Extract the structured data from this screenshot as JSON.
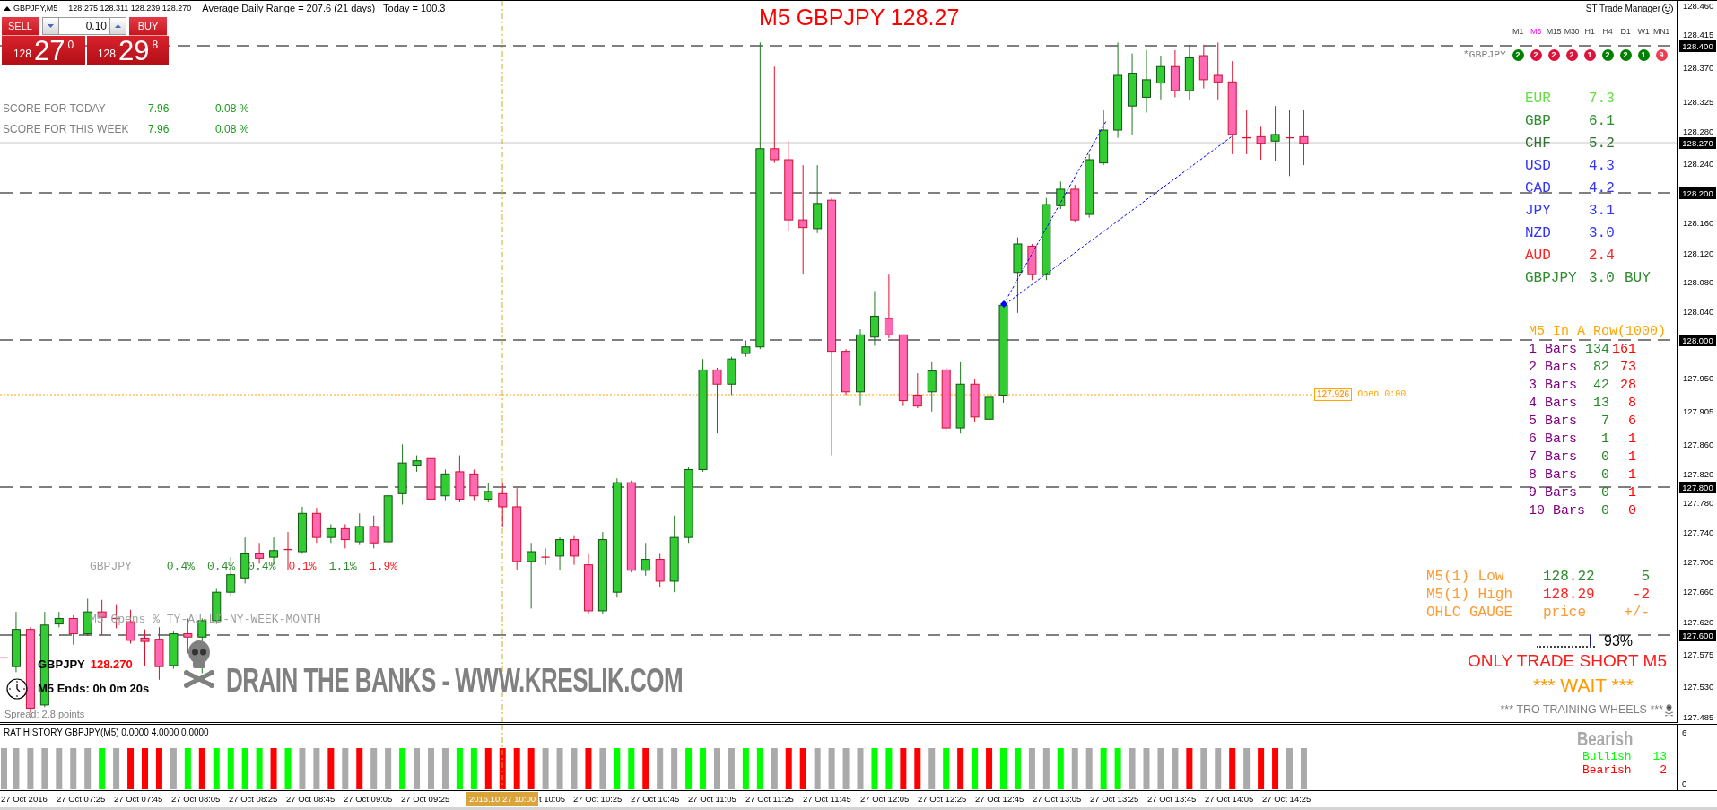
{
  "header": {
    "symbol": "GBPJPY,M5",
    "quotes": "128.275 128.311 128.239 128.270",
    "range": "Average Daily Range = 207.6 (21 days)",
    "today": "Today = 100.3"
  },
  "trade_panel": {
    "sell": {
      "label": "SELL",
      "big_figure": "128",
      "pips": "27",
      "fraction": "0"
    },
    "lot": "0.10",
    "buy": {
      "label": "BUY",
      "big_figure": "128",
      "pips": "29",
      "fraction": "8"
    }
  },
  "scores": [
    {
      "label": "SCORE FOR TODAY",
      "points": "7.96",
      "percent": "0.08 %"
    },
    {
      "label": "SCORE FOR THIS WEEK",
      "points": "7.96",
      "percent": "0.08 %"
    }
  ],
  "chart_title": "M5 GBPJPY 128.27",
  "trade_manager": "ST Trade Manager",
  "trend_matrix": {
    "symbol": "*GBPJPY",
    "timeframes": [
      {
        "label": "M1",
        "selected": false,
        "count": "2",
        "color": "#008000"
      },
      {
        "label": "M5",
        "selected": true,
        "count": "2",
        "color": "#dc143c"
      },
      {
        "label": "M15",
        "selected": false,
        "count": "2",
        "color": "#dc143c"
      },
      {
        "label": "M30",
        "selected": false,
        "count": "2",
        "color": "#dc143c"
      },
      {
        "label": "H1",
        "selected": false,
        "count": "1",
        "color": "#dc143c"
      },
      {
        "label": "H4",
        "selected": false,
        "count": "2",
        "color": "#008000"
      },
      {
        "label": "D1",
        "selected": false,
        "count": "2",
        "color": "#008000"
      },
      {
        "label": "W1",
        "selected": false,
        "count": "1",
        "color": "#008000"
      },
      {
        "label": "MN1",
        "selected": false,
        "count": "9",
        "color": "#f03c50"
      }
    ]
  },
  "currency_strength": [
    {
      "name": "EUR",
      "value": "7.3",
      "color": "#66dd44"
    },
    {
      "name": "GBP",
      "value": "6.1",
      "color": "#2e8b2e"
    },
    {
      "name": "CHF",
      "value": "5.2",
      "color": "#2f6f2f"
    },
    {
      "name": "USD",
      "value": "4.3",
      "color": "#3333ff"
    },
    {
      "name": "CAD",
      "value": "4.2",
      "color": "#3333ff"
    },
    {
      "name": "JPY",
      "value": "3.1",
      "color": "#3333ff"
    },
    {
      "name": "NZD",
      "value": "3.0",
      "color": "#3333ff"
    },
    {
      "name": "AUD",
      "value": "2.4",
      "color": "#ff2222"
    },
    {
      "name": "GBPJPY",
      "value": "3.0",
      "signal": "BUY",
      "color": "#2e8b2e"
    }
  ],
  "in_a_row": {
    "title": "M5 In A Row(1000)",
    "rows": [
      {
        "label": "1 Bars",
        "bullish": "134",
        "bearish": "161"
      },
      {
        "label": "2 Bars",
        "bullish": "82",
        "bearish": "73"
      },
      {
        "label": "3 Bars",
        "bullish": "42",
        "bearish": "28"
      },
      {
        "label": "4 Bars",
        "bullish": "13",
        "bearish": "8"
      },
      {
        "label": "5 Bars",
        "bullish": "7",
        "bearish": "6"
      },
      {
        "label": "6 Bars",
        "bullish": "1",
        "bearish": "1"
      },
      {
        "label": "7 Bars",
        "bullish": "0",
        "bearish": "1"
      },
      {
        "label": "8 Bars",
        "bullish": "0",
        "bearish": "1"
      },
      {
        "label": "9 Bars",
        "bullish": "0",
        "bearish": "1"
      },
      {
        "label": "10 Bars",
        "bullish": "0",
        "bearish": "0"
      }
    ]
  },
  "open_marker": {
    "price": "127.926",
    "label": "Open 0:00"
  },
  "ohlc_gauge": {
    "rows": [
      {
        "label": "M5(1) Low",
        "price": "128.22",
        "change": "5",
        "color": "#2e8b2e"
      },
      {
        "label": "M5(1) High",
        "price": "128.29",
        "change": "-2",
        "color": "#ff2222"
      },
      {
        "label": "OHLC GAUGE",
        "price": "price",
        "change": "+/-",
        "color": "#ff9933"
      }
    ],
    "level": 0.93,
    "reading": "93%"
  },
  "signal": {
    "advice": "ONLY TRADE SHORT M5",
    "action": "*** WAIT ***",
    "footer": "*** TRO TRAINING WHEELS ***"
  },
  "session_opens": {
    "symbol": "GBPJPY",
    "values": [
      {
        "text": "0.4%",
        "color": "#2e8b2e"
      },
      {
        "text": "0.4%",
        "color": "#2e8b2e"
      },
      {
        "text": "0.4%",
        "color": "#2e8b2e"
      },
      {
        "text": "0.1%",
        "color": "#ff2222"
      },
      {
        "text": "1.1%",
        "color": "#2e8b2e"
      },
      {
        "text": "1.9%",
        "color": "#ff2222"
      }
    ],
    "caption": "M5 Opens % TY-AU-LD-NY-WEEK-MONTH"
  },
  "countdown": {
    "symbol": "GBPJPY",
    "price": "128.270",
    "ends": "M5 Ends: 0h 0m 20s",
    "spread": "Spread: 2.8 points"
  },
  "banner": "DRAIN THE BANKS - WWW.KRESLIK.COM",
  "price_axis": [
    {
      "label": "128.460",
      "kind": "tick"
    },
    {
      "label": "128.415",
      "kind": "tick"
    },
    {
      "label": "128.400",
      "kind": "marker"
    },
    {
      "label": "128.370",
      "kind": "tick"
    },
    {
      "label": "128.325",
      "kind": "tick"
    },
    {
      "label": "128.280",
      "kind": "tick"
    },
    {
      "label": "128.270",
      "kind": "marker"
    },
    {
      "label": "128.240",
      "kind": "tick"
    },
    {
      "label": "128.200",
      "kind": "marker"
    },
    {
      "label": "128.160",
      "kind": "tick"
    },
    {
      "label": "128.120",
      "kind": "tick"
    },
    {
      "label": "128.080",
      "kind": "tick"
    },
    {
      "label": "128.040",
      "kind": "tick"
    },
    {
      "label": "128.000",
      "kind": "marker"
    },
    {
      "label": "127.950",
      "kind": "tick"
    },
    {
      "label": "127.905",
      "kind": "tick"
    },
    {
      "label": "127.860",
      "kind": "tick"
    },
    {
      "label": "127.820",
      "kind": "tick"
    },
    {
      "label": "127.800",
      "kind": "marker"
    },
    {
      "label": "127.780",
      "kind": "tick"
    },
    {
      "label": "127.740",
      "kind": "tick"
    },
    {
      "label": "127.700",
      "kind": "tick"
    },
    {
      "label": "127.660",
      "kind": "tick"
    },
    {
      "label": "127.620",
      "kind": "tick"
    },
    {
      "label": "127.600",
      "kind": "marker"
    },
    {
      "label": "127.575",
      "kind": "tick"
    },
    {
      "label": "127.530",
      "kind": "tick"
    },
    {
      "label": "127.485",
      "kind": "tick"
    }
  ],
  "indicator": {
    "title": "RAT HISTORY GBPJPY(M5) 0.0000 4.0000 0.0000",
    "heading": "Bearish",
    "counts": [
      {
        "label": "Bullish",
        "value": "13",
        "color": "#00ff00"
      },
      {
        "label": "Bearish",
        "value": "2",
        "color": "#ff0000"
      }
    ],
    "axis": [
      "6",
      "0"
    ]
  },
  "time_axis": {
    "cursor": "2016.10.27 10:00",
    "labels": [
      {
        "text": "27 Oct 2016",
        "kind": "date"
      },
      {
        "text": "27 Oct 07:25",
        "kind": "time"
      },
      {
        "text": "27 Oct 07:45",
        "kind": "time"
      },
      {
        "text": "27 Oct 08:05",
        "kind": "time"
      },
      {
        "text": "27 Oct 08:25",
        "kind": "time"
      },
      {
        "text": "27 Oct 08:45",
        "kind": "time"
      },
      {
        "text": "27 Oct 09:05",
        "kind": "time"
      },
      {
        "text": "27 Oct 09:25",
        "kind": "time"
      },
      {
        "text": "t 10:05",
        "kind": "partial"
      },
      {
        "text": "27 Oct 10:25",
        "kind": "time"
      },
      {
        "text": "27 Oct 10:45",
        "kind": "time"
      },
      {
        "text": "27 Oct 11:05",
        "kind": "time"
      },
      {
        "text": "27 Oct 11:25",
        "kind": "time"
      },
      {
        "text": "27 Oct 11:45",
        "kind": "time"
      },
      {
        "text": "27 Oct 12:05",
        "kind": "time"
      },
      {
        "text": "27 Oct 12:25",
        "kind": "time"
      },
      {
        "text": "27 Oct 12:45",
        "kind": "time"
      },
      {
        "text": "27 Oct 13:05",
        "kind": "time"
      },
      {
        "text": "27 Oct 13:25",
        "kind": "time"
      },
      {
        "text": "27 Oct 13:45",
        "kind": "time"
      },
      {
        "text": "27 Oct 14:05",
        "kind": "time"
      },
      {
        "text": "27 Oct 14:25",
        "kind": "time"
      }
    ]
  }
}
